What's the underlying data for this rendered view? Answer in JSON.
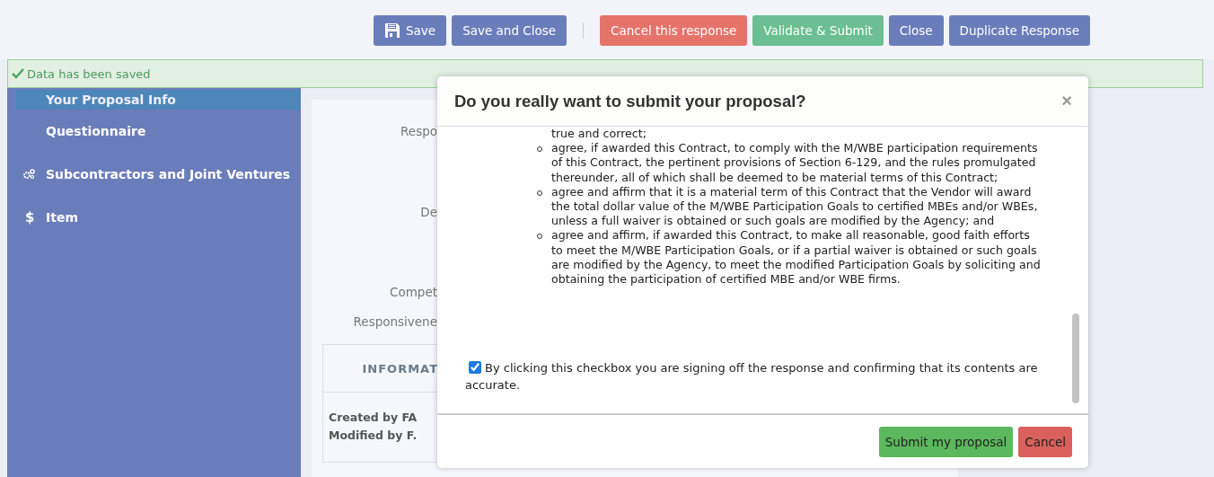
{
  "toolbar": {
    "buttons": [
      {
        "label": "Save",
        "kind": "primary"
      },
      {
        "label": "Save and Close",
        "kind": "primary"
      },
      {
        "label": "Cancel this response",
        "kind": "danger"
      },
      {
        "label": "Validate & Submit",
        "kind": "success"
      },
      {
        "label": "Close",
        "kind": "primary"
      },
      {
        "label": "Duplicate Response",
        "kind": "primary"
      }
    ]
  },
  "notification": {
    "text": "Data has been saved"
  },
  "sidebar": {
    "items": [
      {
        "label": "Your Proposal Info",
        "selected": true
      },
      {
        "label": "Questionnaire",
        "selected": false
      },
      {
        "label": "Subcontractors and Joint Ventures",
        "selected": false
      },
      {
        "label": "Item",
        "selected": false,
        "glyph": "$"
      }
    ]
  },
  "form": {
    "labels": [
      "Respo",
      "De",
      "Compet",
      "Responsivene"
    ],
    "info_panel": {
      "heading": "INFORMAT",
      "lines": [
        "Created by FA",
        "Modified by F."
      ]
    }
  },
  "dialog": {
    "title": "Do you really want to submit your proposal?",
    "close": "×",
    "lead_line": "true and correct;",
    "bullets": [
      "agree, if awarded this Contract, to comply with the M/WBE participation requirements of this Contract, the pertinent provisions of Section 6-129, and the rules promulgated thereunder, all of which shall be deemed to be material terms of this Contract;",
      "agree and affirm that it is a material term of this Contract that the Vendor will award the total dollar value of the M/WBE Participation Goals to certified MBEs and/or WBEs, unless a full waiver is obtained or such goals are modified by the Agency; and",
      "agree and affirm, if awarded this Contract, to make all reasonable, good faith efforts to meet the M/WBE Participation Goals, or if a partial waiver is obtained or such goals are modified by the Agency, to meet the modified Participation Goals by soliciting and obtaining the participation of certified MBE and/or WBE firms."
    ],
    "confirm": {
      "label": "By clicking this checkbox you are signing off the response and confirming that its contents are accurate.",
      "checked": true
    },
    "buttons": [
      {
        "label": "Submit my proposal",
        "kind": "success"
      },
      {
        "label": "Cancel",
        "kind": "danger"
      }
    ]
  }
}
